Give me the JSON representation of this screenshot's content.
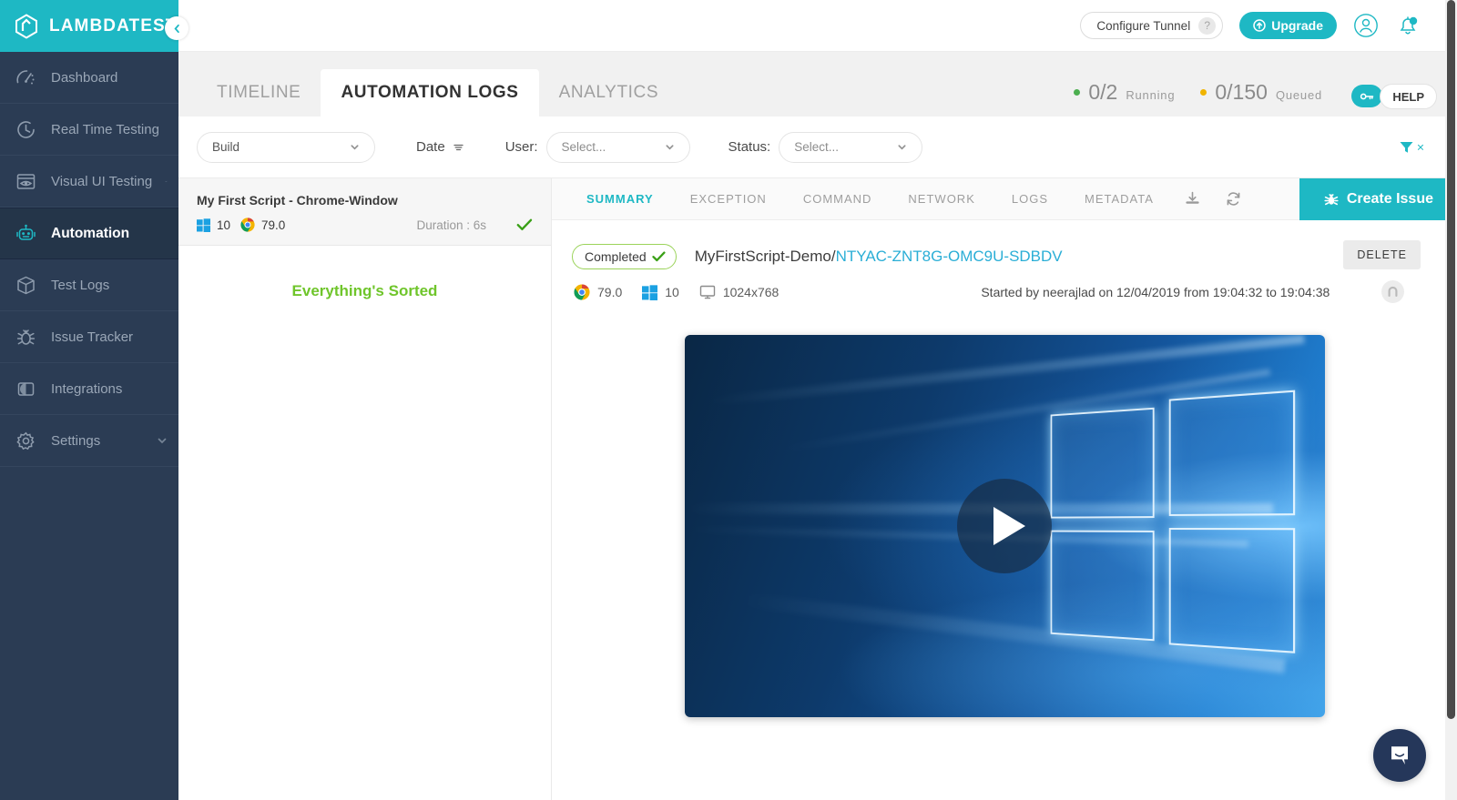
{
  "brand": {
    "name": "LAMBDATEST",
    "logo_icon": "lambdatest-logo-icon",
    "collapse_icon": "chevron-left-icon",
    "accent": "#1eb8c4"
  },
  "sidebar": {
    "items": [
      {
        "label": "Dashboard",
        "icon": "speedometer-icon",
        "active": false,
        "caret": false
      },
      {
        "label": "Real Time Testing",
        "icon": "clock-icon",
        "active": false,
        "caret": false
      },
      {
        "label": "Visual UI Testing",
        "icon": "eye-browser-icon",
        "active": false,
        "caret": true
      },
      {
        "label": "Automation",
        "icon": "robot-icon",
        "active": true,
        "caret": false
      },
      {
        "label": "Test Logs",
        "icon": "box-icon",
        "active": false,
        "caret": false
      },
      {
        "label": "Issue Tracker",
        "icon": "bug-icon",
        "active": false,
        "caret": false
      },
      {
        "label": "Integrations",
        "icon": "puzzle-circle-icon",
        "active": false,
        "caret": false
      },
      {
        "label": "Settings",
        "icon": "gear-icon",
        "active": false,
        "caret": true
      }
    ]
  },
  "topbar": {
    "tunnel_label": "Configure Tunnel",
    "tunnel_help_glyph": "?",
    "upgrade_label": "Upgrade",
    "account_icon": "user-circle-icon",
    "notification_icon": "bell-icon"
  },
  "main_tabs": [
    {
      "label": "TIMELINE",
      "active": false
    },
    {
      "label": "AUTOMATION LOGS",
      "active": true
    },
    {
      "label": "ANALYTICS",
      "active": false
    }
  ],
  "counters": [
    {
      "value": "0/2",
      "caption": "Running",
      "dot_color": "#4caf50"
    },
    {
      "value": "0/150",
      "caption": "Queued",
      "dot_color": "#f0b400"
    }
  ],
  "key_button": {
    "icon": "key-icon"
  },
  "help_button": {
    "label": "HELP"
  },
  "filters": {
    "build": {
      "value": "Build",
      "caret_icon": "chevron-down-icon"
    },
    "date": {
      "label": "Date",
      "icon": "sort-filter-icon"
    },
    "user": {
      "label": "User:",
      "value": "Select...",
      "placeholder": "Select..."
    },
    "status": {
      "label": "Status:",
      "value": "Select...",
      "placeholder": "Select..."
    },
    "clear": {
      "icon": "funnel-icon",
      "x": "×"
    }
  },
  "test_list": {
    "items": [
      {
        "name": "My First Script - Chrome-Window",
        "os_icon": "windows-icon",
        "os_version": "10",
        "browser_icon": "chrome-icon",
        "browser_version": "79.0",
        "duration": "Duration : 6s",
        "status_icon": "check-icon"
      }
    ],
    "empty_message": "Everything's Sorted"
  },
  "detail_tabs": [
    {
      "label": "SUMMARY",
      "active": true
    },
    {
      "label": "EXCEPTION",
      "active": false
    },
    {
      "label": "COMMAND",
      "active": false
    },
    {
      "label": "NETWORK",
      "active": false
    },
    {
      "label": "LOGS",
      "active": false
    },
    {
      "label": "METADATA",
      "active": false
    }
  ],
  "detail_actions": {
    "download_icon": "download-icon",
    "refresh_icon": "refresh-icon",
    "create_issue_label": "Create Issue",
    "create_issue_icon": "bug-icon"
  },
  "session": {
    "status_label": "Completed",
    "status_check": "✔",
    "build_name": "MyFirstScript-Demo/",
    "session_id": "NTYAC-ZNT8G-OMC9U-SDBDV",
    "delete_label": "DELETE",
    "avatar_initial": "n",
    "browser_icon": "chrome-icon",
    "browser_version": "79.0",
    "os_icon": "windows-icon",
    "os_version": "10",
    "resolution_icon": "monitor-icon",
    "resolution": "1024x768",
    "started_by": "Started by neerajlad on 12/04/2019 from 19:04:32 to 19:04:38"
  },
  "video": {
    "play_icon": "play-icon",
    "alt": "Windows 10 desktop recording"
  },
  "chat_widget": {
    "icon": "chat-bubble-icon"
  }
}
